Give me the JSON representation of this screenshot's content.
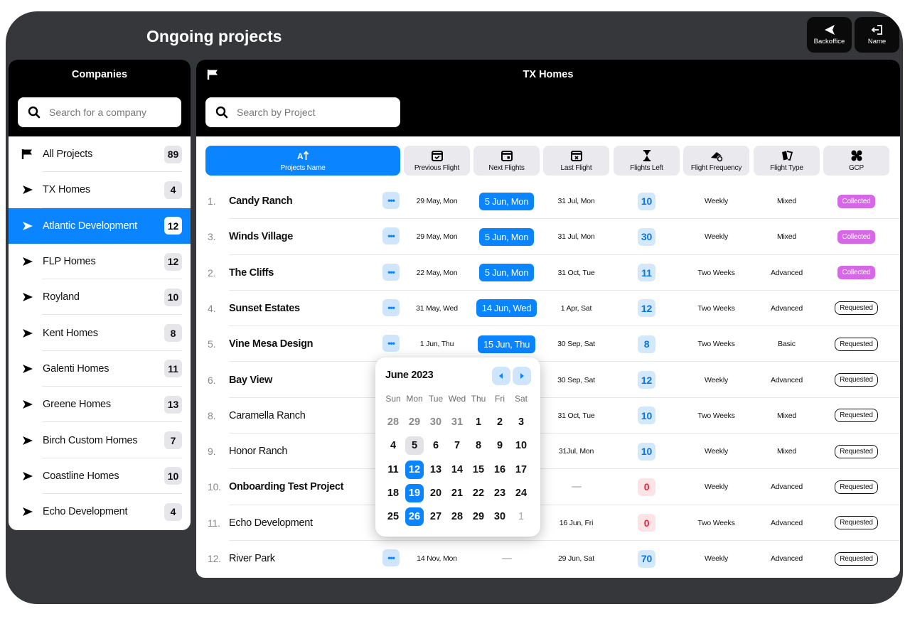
{
  "header": {
    "title": "Ongoing projects",
    "backoffice_label": "Backoffice",
    "name_label": "Name"
  },
  "companies": {
    "title": "Companies",
    "search_placeholder": "Search for a company",
    "items": [
      {
        "label": "All Projects",
        "count": "89",
        "icon": "flag-icon"
      },
      {
        "label": "TX Homes",
        "count": "4",
        "icon": "arrow-icon"
      },
      {
        "label": "Atlantic Development",
        "count": "12",
        "icon": "arrow-icon",
        "active": true
      },
      {
        "label": "FLP Homes",
        "count": "12",
        "icon": "arrow-icon"
      },
      {
        "label": "Royland",
        "count": "10",
        "icon": "arrow-icon"
      },
      {
        "label": "Kent Homes",
        "count": "8",
        "icon": "arrow-icon"
      },
      {
        "label": "Galenti Homes",
        "count": "11",
        "icon": "arrow-icon"
      },
      {
        "label": "Greene Homes",
        "count": "13",
        "icon": "arrow-icon"
      },
      {
        "label": "Birch Custom Homes",
        "count": "7",
        "icon": "arrow-icon"
      },
      {
        "label": "Coastline Homes",
        "count": "10",
        "icon": "arrow-icon"
      },
      {
        "label": "Echo Development",
        "count": "4",
        "icon": "arrow-icon"
      }
    ]
  },
  "main": {
    "title": "TX Homes",
    "search_placeholder": "Search by Project",
    "columns": [
      {
        "key": "name",
        "label": "Projects Name",
        "icon": "sort-az-icon"
      },
      {
        "key": "prev",
        "label": "Previous Flight",
        "icon": "calendar-check-icon"
      },
      {
        "key": "next",
        "label": "Next Flights",
        "icon": "calendar-next-icon"
      },
      {
        "key": "last",
        "label": "Last Flight",
        "icon": "calendar-x-icon"
      },
      {
        "key": "left",
        "label": "Flights Left",
        "icon": "hourglass-icon"
      },
      {
        "key": "freq",
        "label": "Flight Frequency",
        "icon": "drone-refresh-icon"
      },
      {
        "key": "type",
        "label": "Flight Type",
        "icon": "cards-icon"
      },
      {
        "key": "gcp",
        "label": "GCP",
        "icon": "gcp-icon"
      }
    ],
    "rows": [
      {
        "num": "1.",
        "name": "Candy Ranch",
        "prev": "29 May, Mon",
        "next": "5 Jun, Mon",
        "last": "31 Jul, Mon",
        "left": "10",
        "freq": "Weekly",
        "type": "Mixed",
        "gcp": "Collected"
      },
      {
        "num": "3.",
        "name": "Winds Village",
        "prev": "29 May, Mon",
        "next": "5 Jun, Mon",
        "last": "31 Jul, Mon",
        "left": "30",
        "freq": "Weekly",
        "type": "Mixed",
        "gcp": "Collected"
      },
      {
        "num": "2.",
        "name": "The Cliffs",
        "prev": "22 May, Mon",
        "next": "5 Jun, Mon",
        "last": "31 Oct, Tue",
        "left": "11",
        "freq": "Two Weeks",
        "type": "Advanced",
        "gcp": "Collected"
      },
      {
        "num": "4.",
        "name": "Sunset Estates",
        "prev": "31 May, Wed",
        "next": "14 Jun, Wed",
        "last": "1 Apr, Sat",
        "left": "12",
        "freq": "Two Weeks",
        "type": "Advanced",
        "gcp": "Requested"
      },
      {
        "num": "5.",
        "name": "Vine Mesa Design",
        "prev": "1 Jun, Thu",
        "next": "15 Jun, Thu",
        "last": "30 Sep, Sat",
        "left": "8",
        "freq": "Two Weeks",
        "type": "Basic",
        "gcp": "Requested"
      },
      {
        "num": "6.",
        "name": "Bay View",
        "prev": "",
        "next": "",
        "last": "30 Sep, Sat",
        "left": "12",
        "freq": "Weekly",
        "type": "Advanced",
        "gcp": "Requested"
      },
      {
        "num": "8.",
        "name": "Caramella Ranch",
        "prev": "",
        "next": "",
        "last": "31 Oct, Tue",
        "left": "10",
        "freq": "Two Weeks",
        "type": "Mixed",
        "gcp": "Requested"
      },
      {
        "num": "9.",
        "name": "Honor Ranch",
        "prev": "",
        "next": "",
        "last": "31Jul, Mon",
        "left": "10",
        "freq": "Weekly",
        "type": "Mixed",
        "gcp": "Requested"
      },
      {
        "num": "10.",
        "name": "Onboarding Test Project",
        "prev": "",
        "next": "",
        "last": "—",
        "left": "0",
        "freq": "Weekly",
        "type": "Advanced",
        "gcp": "Requested"
      },
      {
        "num": "11.",
        "name": "Echo Development",
        "prev": "",
        "next": "",
        "last": "16 Jun, Fri",
        "left": "0",
        "freq": "Two Weeks",
        "type": "Advanced",
        "gcp": "Requested"
      },
      {
        "num": "12.",
        "name": "River Park",
        "prev": "14 Nov, Mon",
        "next": "—",
        "last": "29 Jun, Sat",
        "left": "70",
        "freq": "Weekly",
        "type": "Advanced",
        "gcp": "Requested"
      }
    ]
  },
  "calendar": {
    "month": "June 2023",
    "weekdays": [
      "Sun",
      "Mon",
      "Tue",
      "Wed",
      "Thu",
      "Fri",
      "Sat"
    ],
    "weeks": [
      [
        "28",
        "29",
        "30",
        "31",
        "1",
        "2",
        "3"
      ],
      [
        "4",
        "5",
        "6",
        "7",
        "8",
        "9",
        "10"
      ],
      [
        "11",
        "12",
        "13",
        "14",
        "15",
        "16",
        "17"
      ],
      [
        "18",
        "19",
        "20",
        "21",
        "22",
        "23",
        "24"
      ],
      [
        "25",
        "26",
        "27",
        "28",
        "29",
        "30",
        "1"
      ]
    ],
    "selected": [
      "12",
      "19",
      "26"
    ],
    "today": "5"
  },
  "colors": {
    "accent": "#0a84ff",
    "collected": "#d667e6",
    "zero": "#e6203d"
  }
}
